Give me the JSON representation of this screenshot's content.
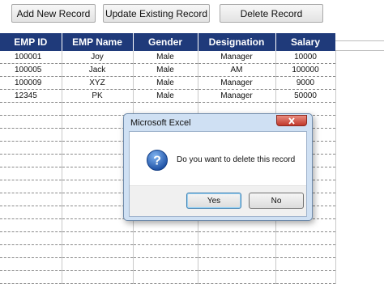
{
  "toolbar": {
    "add_label": "Add New Record",
    "update_label": "Update Existing Record",
    "delete_label": "Delete Record"
  },
  "grid": {
    "header_color": "#1f3a7a",
    "columns": [
      "EMP ID",
      "EMP Name",
      "Gender",
      "Designation",
      "Salary"
    ],
    "rows": [
      [
        "100001",
        "Joy",
        "Male",
        "Manager",
        "10000"
      ],
      [
        "100005",
        "Jack",
        "Male",
        "AM",
        "100000"
      ],
      [
        "100009",
        "XYZ",
        "Male",
        "Manager",
        "9000"
      ],
      [
        "12345",
        "PK",
        "Male",
        "Manager",
        "50000"
      ]
    ]
  },
  "dialog": {
    "title": "Microsoft Excel",
    "message": "Do you want to delete this record",
    "icon": "question-icon",
    "close_icon": "close-icon",
    "yes_label": "Yes",
    "no_label": "No"
  }
}
